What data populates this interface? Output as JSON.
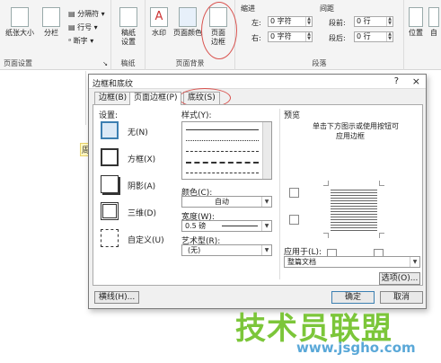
{
  "ribbon": {
    "page_setup": {
      "paper_size": "纸张大小",
      "columns": "分栏",
      "breaks": "分隔符",
      "line_numbers": "行号",
      "hyphenation": "断字",
      "group_title": "页面设置"
    },
    "draft": {
      "draft_settings": "稿纸设置",
      "group_title": "稿纸"
    },
    "page_background": {
      "watermark": "水印",
      "page_color": "页面颜色",
      "page_borders": "页面边框",
      "group_title": "页面背景"
    },
    "paragraph": {
      "indent_title": "缩进",
      "spacing_title": "间距",
      "indent_left_label": "左:",
      "indent_left_value": "0 字符",
      "indent_right_label": "右:",
      "indent_right_value": "0 字符",
      "space_before_label": "段前:",
      "space_before_value": "0 行",
      "space_after_label": "段后:",
      "space_after_value": "0 行",
      "group_title": "段落"
    },
    "arrange": {
      "position": "位置",
      "wrap": "自"
    }
  },
  "document": {
    "mark": "周"
  },
  "dialog": {
    "title": "边框和底纹",
    "help": "?",
    "close": "×",
    "tabs": [
      {
        "label": "边框(B)"
      },
      {
        "label": "页面边框(P)"
      },
      {
        "label": "底纹(S)"
      }
    ],
    "settings_label": "设置:",
    "settings": [
      {
        "label": "无(N)"
      },
      {
        "label": "方框(X)"
      },
      {
        "label": "阴影(A)"
      },
      {
        "label": "三维(D)"
      },
      {
        "label": "自定义(U)"
      }
    ],
    "style_label": "样式(Y):",
    "color_label": "颜色(C):",
    "color_value": "自动",
    "width_label": "宽度(W):",
    "width_value": "0.5 磅",
    "art_label": "艺术型(R):",
    "art_value": "(无)",
    "preview_label": "预览",
    "preview_hint_1": "单击下方图示或使用按钮可",
    "preview_hint_2": "应用边框",
    "apply_to_label": "应用于(L):",
    "apply_to_value": "整篇文档",
    "options_button": "选项(O)...",
    "horizontal_line_button": "横线(H)...",
    "ok_button": "确定",
    "cancel_button": "取消"
  },
  "watermark": {
    "text": "技术员联盟",
    "url": "www.jsgho.com"
  }
}
